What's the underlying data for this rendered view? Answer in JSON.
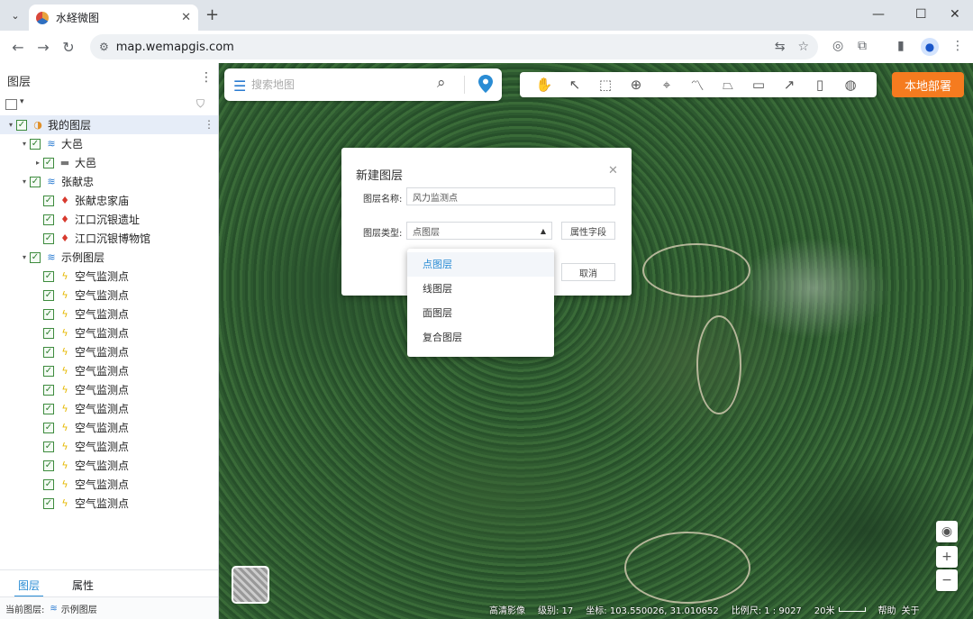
{
  "browser": {
    "tab_title": "水経微图",
    "url": "map.wemapgis.com"
  },
  "sidebar": {
    "title": "图层",
    "tree": [
      {
        "label": "我的图层",
        "level": 0,
        "arrow": "▾",
        "icon": "globe-icon",
        "selected": true
      },
      {
        "label": "大邑",
        "level": 1,
        "arrow": "▾",
        "icon": "layer-icon"
      },
      {
        "label": "大邑",
        "level": 2,
        "arrow": "▸",
        "icon": "folder-icon"
      },
      {
        "label": "张献忠",
        "level": 1,
        "arrow": "▾",
        "icon": "layer-icon"
      },
      {
        "label": "张献忠家庙",
        "level": 2,
        "arrow": "",
        "icon": "pin-icon"
      },
      {
        "label": "江口沉银遗址",
        "level": 2,
        "arrow": "",
        "icon": "pin-icon"
      },
      {
        "label": "江口沉银博物馆",
        "level": 2,
        "arrow": "",
        "icon": "pin-icon"
      },
      {
        "label": "示例图层",
        "level": 1,
        "arrow": "▾",
        "icon": "layer-icon"
      },
      {
        "label": "空气监测点",
        "level": 2,
        "arrow": "",
        "icon": "bolt-icon"
      },
      {
        "label": "空气监测点",
        "level": 2,
        "arrow": "",
        "icon": "bolt-icon"
      },
      {
        "label": "空气监测点",
        "level": 2,
        "arrow": "",
        "icon": "bolt-icon"
      },
      {
        "label": "空气监测点",
        "level": 2,
        "arrow": "",
        "icon": "bolt-icon"
      },
      {
        "label": "空气监测点",
        "level": 2,
        "arrow": "",
        "icon": "bolt-icon"
      },
      {
        "label": "空气监测点",
        "level": 2,
        "arrow": "",
        "icon": "bolt-icon"
      },
      {
        "label": "空气监测点",
        "level": 2,
        "arrow": "",
        "icon": "bolt-icon"
      },
      {
        "label": "空气监测点",
        "level": 2,
        "arrow": "",
        "icon": "bolt-icon"
      },
      {
        "label": "空气监测点",
        "level": 2,
        "arrow": "",
        "icon": "bolt-icon"
      },
      {
        "label": "空气监测点",
        "level": 2,
        "arrow": "",
        "icon": "bolt-icon"
      },
      {
        "label": "空气监测点",
        "level": 2,
        "arrow": "",
        "icon": "bolt-icon"
      },
      {
        "label": "空气监测点",
        "level": 2,
        "arrow": "",
        "icon": "bolt-icon"
      },
      {
        "label": "空气监测点",
        "level": 2,
        "arrow": "",
        "icon": "bolt-icon"
      }
    ],
    "tabs": {
      "layers": "图层",
      "properties": "属性"
    },
    "status": {
      "label": "当前图层:",
      "value": "示例图层"
    }
  },
  "map": {
    "search_placeholder": "搜索地图",
    "deploy_label": "本地部署",
    "status": {
      "imagery": "高清影像",
      "level": "级别: 17",
      "coords": "坐标: 103.550026, 31.010652",
      "scale": "比例尺: 1 : 9027",
      "scale_bar": "20米",
      "help": "帮助",
      "about": "关于"
    }
  },
  "dialog": {
    "title": "新建图层",
    "name_label": "图层名称:",
    "name_value": "风力监测点",
    "type_label": "图层类型:",
    "type_value": "点图层",
    "attr_button": "属性字段",
    "cancel_button": "取消",
    "options": [
      "点图层",
      "线图层",
      "面图层",
      "复合图层"
    ]
  },
  "colors": {
    "accent": "#2a8cd4",
    "deploy": "#f57b1f",
    "check": "#2f7d2f"
  }
}
